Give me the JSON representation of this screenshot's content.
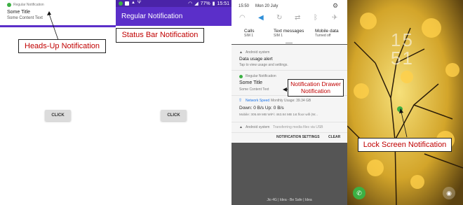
{
  "headsup": {
    "app_name": "Regular Notification",
    "title": "Some Title",
    "content": "Some Content Text",
    "button": "CLICK",
    "callout": "Heads-Up Notification"
  },
  "statusbar": {
    "app_title": "Regular Notification",
    "battery": "77%",
    "time": "15:51",
    "button": "CLICK",
    "callout": "Status Bar Notification"
  },
  "drawer": {
    "time": "15:50",
    "date": "Mon 20 July",
    "quick": [
      {
        "label": "Calls",
        "sub": "SIM 1"
      },
      {
        "label": "Text messages",
        "sub": "SIM 1"
      },
      {
        "label": "Mobile data",
        "sub": "Turned off"
      }
    ],
    "n1": {
      "app": "Android system",
      "title": "Data usage alert",
      "text": "Tap to view usage and settings."
    },
    "n2": {
      "app": "Regular Notification",
      "title": "Some Title",
      "text": "Some Content Text"
    },
    "n3": {
      "app": "Network Speed",
      "meta": "Monthly Usage: 39.34 GB",
      "line1": "Down: 0 B/s  Up: 0 B/s",
      "line2": "Mobile: 305.69 MB  WiFi: 463.84 MB  1st floor wifi (W..."
    },
    "n4": {
      "app": "Android system",
      "text": "Transferring media files via USB"
    },
    "settings_btn": "NOTIFICATION SETTINGS",
    "clear_btn": "CLEAR",
    "carrier": "Jio 4G | Idea - Be Safe | Idea",
    "callout": "Notification Drawer Notification"
  },
  "lock": {
    "callout": "Lock Screen Notification",
    "clock_partial": "15 51"
  },
  "colors": {
    "purple": "#5b2fc9",
    "purple_dark": "#4a23a8",
    "accent_green": "#3cb043",
    "blue": "#1a73e8",
    "callout_red": "#c00000"
  }
}
